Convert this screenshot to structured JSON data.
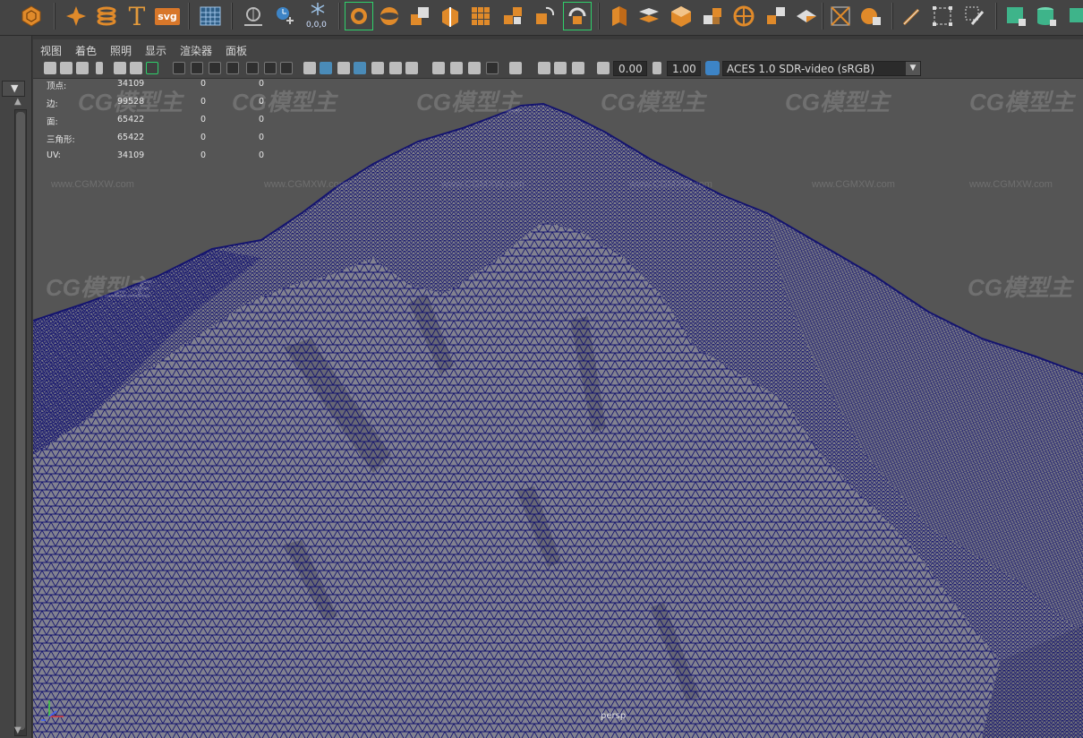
{
  "shelf": {
    "text_tool_label": "T",
    "svg_tool_label": "svg",
    "coord_label": "0,0,0"
  },
  "panel_menu": [
    "视图",
    "着色",
    "照明",
    "显示",
    "渲染器",
    "面板"
  ],
  "toolbar": {
    "exposure": "0.00",
    "gamma": "1.00",
    "color_space": "ACES 1.0 SDR-video (sRGB)"
  },
  "hud": {
    "rows": [
      {
        "label": "顶点:",
        "count": "34109",
        "sel1": "0",
        "sel2": "0"
      },
      {
        "label": "边:",
        "count": "99528",
        "sel1": "0",
        "sel2": "0"
      },
      {
        "label": "面:",
        "count": "65422",
        "sel1": "0",
        "sel2": "0"
      },
      {
        "label": "三角形:",
        "count": "65422",
        "sel1": "0",
        "sel2": "0"
      },
      {
        "label": "UV:",
        "count": "34109",
        "sel1": "0",
        "sel2": "0"
      }
    ]
  },
  "viewport": {
    "camera": "persp",
    "watermark": "CG模型主",
    "watermark_url": "www.CGMXW.com",
    "wire_color": "#14146e",
    "mesh_color": "#7e7e8a",
    "background": "#555555"
  }
}
